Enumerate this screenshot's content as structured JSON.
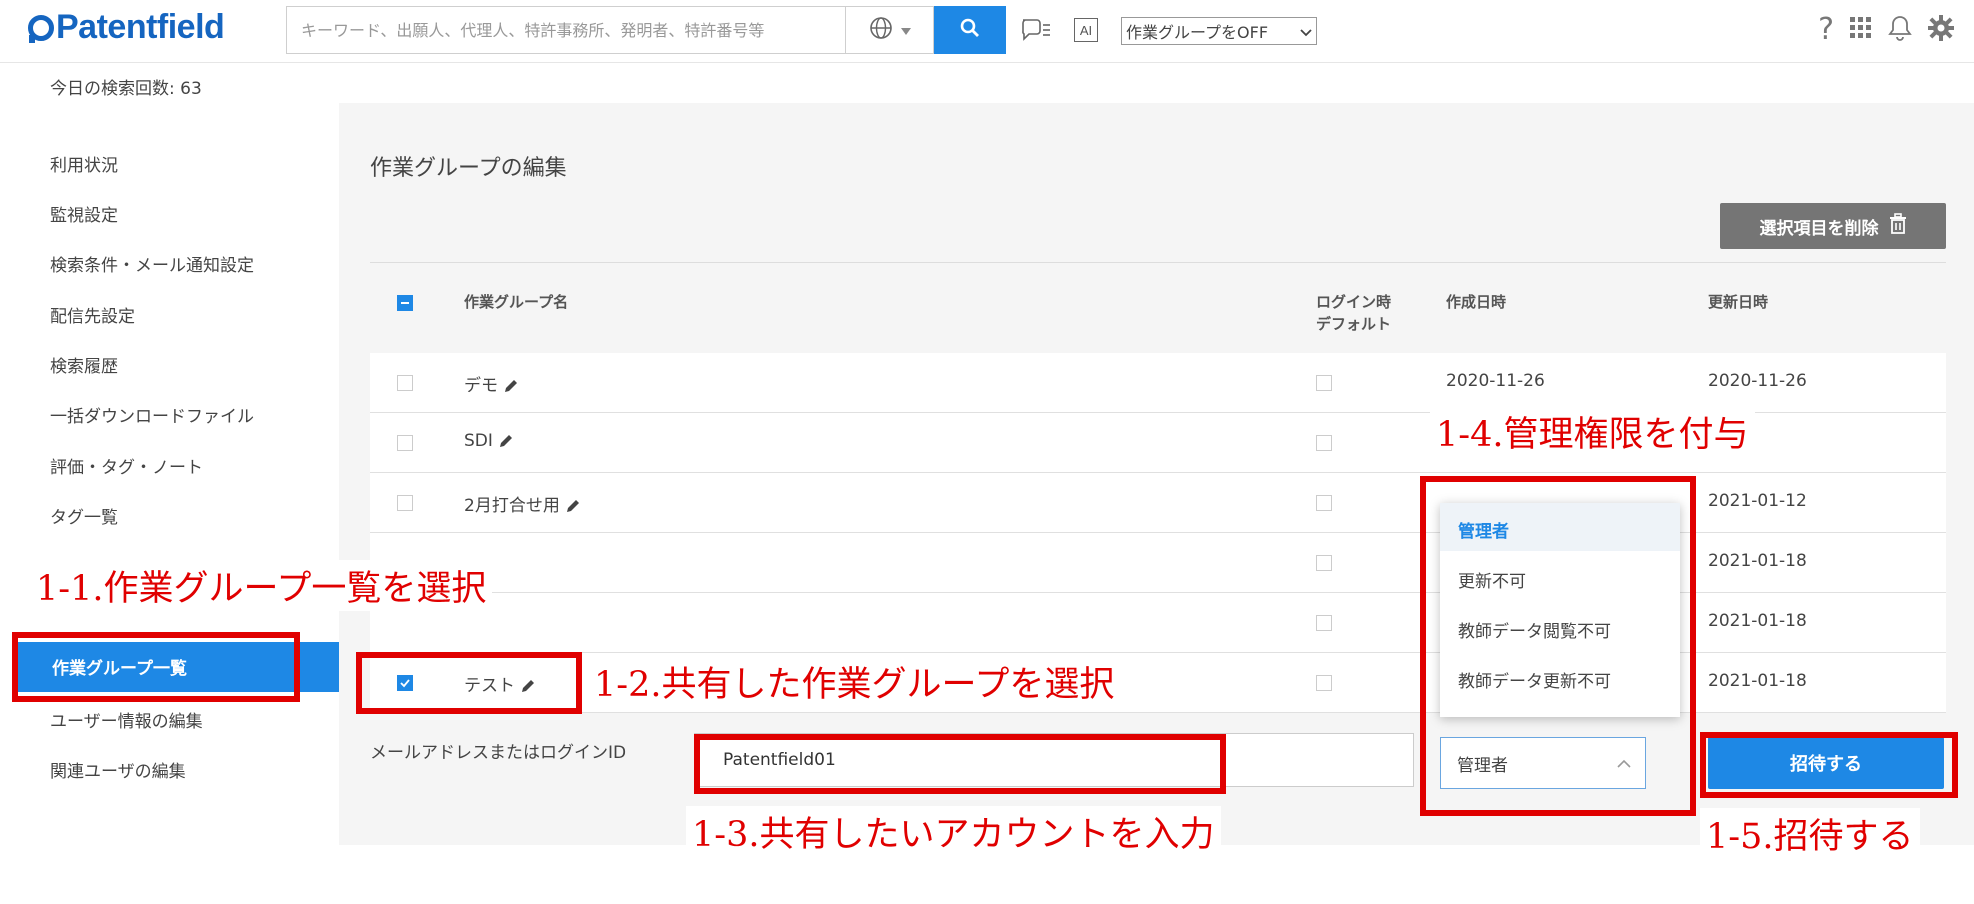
{
  "header": {
    "logo_text": "Patentfield",
    "search_placeholder": "キーワード、出願人、代理人、特許事務所、発明者、特許番号等",
    "ai_label": "AI",
    "group_select_value": "作業グループをOFF"
  },
  "search_count": "今日の検索回数: 63",
  "sidebar": {
    "items": [
      "利用状況",
      "監視設定",
      "検索条件・メール通知設定",
      "配信先設定",
      "検索履歴",
      "一括ダウンロードファイル",
      "評価・タグ・ノート",
      "タグ一覧"
    ],
    "active_item": "作業グループ一覧",
    "bottom_items": [
      "ユーザー情報の編集",
      "関連ユーザの編集"
    ]
  },
  "main": {
    "title": "作業グループの編集",
    "delete_button": "選択項目を削除",
    "table": {
      "headers": {
        "name": "作業グループ名",
        "login_default_1": "ログイン時",
        "login_default_2": "デフォルト",
        "created": "作成日時",
        "updated": "更新日時"
      },
      "rows": [
        {
          "name": "デモ",
          "created": "2020-11-26",
          "updated": "2020-11-26"
        },
        {
          "name": "SDI",
          "created": "",
          "updated": ""
        },
        {
          "name": "2月打合せ用",
          "created": "",
          "updated": "2021-01-12"
        },
        {
          "name": "",
          "created": "",
          "updated": "2021-01-18"
        },
        {
          "name": "",
          "created": "",
          "updated": "2021-01-18"
        },
        {
          "name": "テスト",
          "created": "",
          "updated": "2021-01-18"
        }
      ]
    },
    "email_label": "メールアドレスまたはログインID",
    "email_value": "Patentfield01",
    "role_value": "管理者",
    "invite_button": "招待する",
    "role_options": [
      "管理者",
      "更新不可",
      "教師データ閲覧不可",
      "教師データ更新不可"
    ]
  },
  "annotations": {
    "a1": "1-1.作業グループ一覧を選択",
    "a2": "1-2.共有した作業グループを選択",
    "a3": "1-3.共有したいアカウントを入力",
    "a4": "1-4.管理権限を付与",
    "a5": "1-5.招待する"
  },
  "colors": {
    "brand_blue": "#1e88e5",
    "annotation_red": "#e00000"
  }
}
